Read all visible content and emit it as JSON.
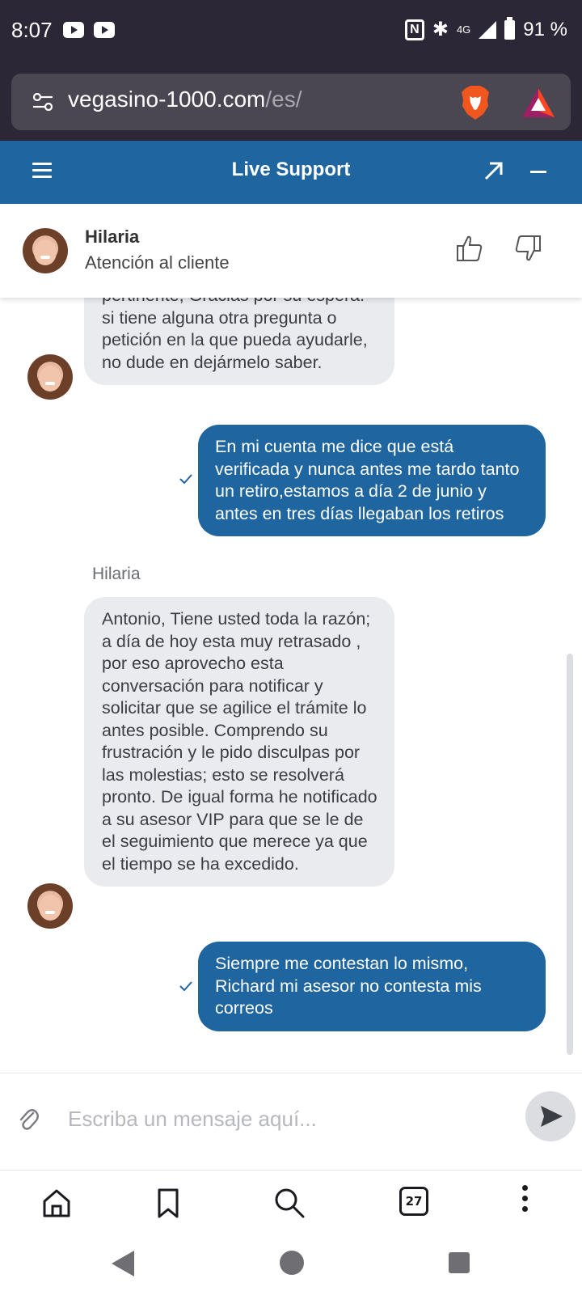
{
  "status_bar": {
    "time": "8:07",
    "network": "4G",
    "battery": "91 %"
  },
  "browser": {
    "url_domain": "vegasino-1000.com",
    "url_path": "/es/",
    "tab_count": "27"
  },
  "support_header": {
    "title": "Live Support"
  },
  "agent": {
    "name": "Hilaria",
    "role": "Atención al cliente"
  },
  "messages": [
    {
      "from": "agent",
      "text": "pertinente, Gracias por su espera. si tiene alguna otra pregunta o petición en la que pueda ayudarle, no dude en dejármelo saber."
    },
    {
      "from": "user",
      "text": "En mi cuenta me dice que está verificada y nunca antes me tardo tanto un retiro,estamos a día 2 de junio y antes en tres días llegaban los retiros"
    },
    {
      "from": "agent",
      "sender": "Hilaria",
      "text": "Antonio, Tiene usted toda la razón; a día de hoy esta muy retrasado , por eso aprovecho esta conversación para notificar y solicitar que se agilice el trámite lo antes posible. Comprendo su frustración y le pido disculpas por las molestias; esto se resolverá pronto. De igual forma he notificado a su asesor VIP para que se le de el seguimiento que merece ya que el tiempo se ha excedido."
    },
    {
      "from": "user",
      "text": "Siempre me contestan lo mismo, Richard mi asesor no contesta mis correos"
    }
  ],
  "composer": {
    "placeholder": "Escriba un mensaje aquí..."
  },
  "colors": {
    "header_blue": "#1f65a0",
    "user_bubble": "#1f65a0",
    "agent_bubble": "#eaebee",
    "status_bar": "#2b2737"
  }
}
